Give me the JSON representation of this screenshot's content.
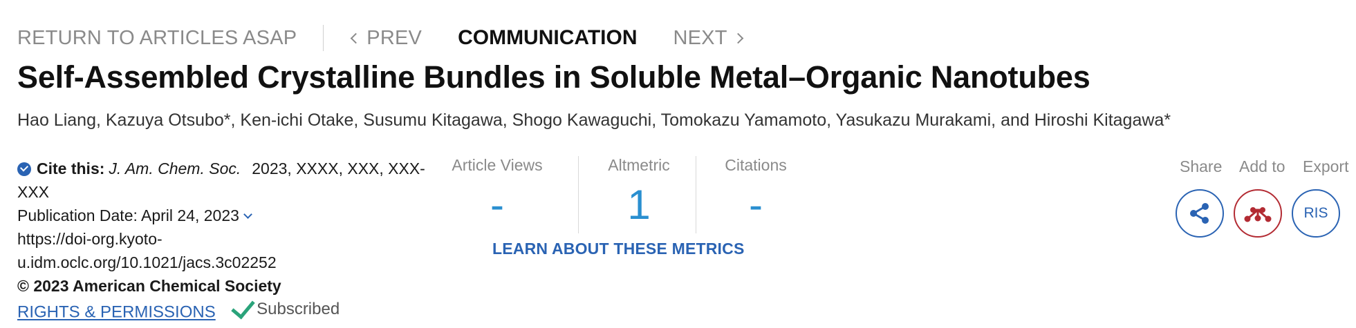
{
  "nav": {
    "return": "RETURN TO ARTICLES ASAP",
    "prev": "PREV",
    "current": "COMMUNICATION",
    "next": "NEXT"
  },
  "article": {
    "title": "Self-Assembled Crystalline Bundles in Soluble Metal–Organic Nanotubes",
    "authors": "Hao Liang, Kazuya Otsubo*, Ken-ichi Otake, Susumu Kitagawa, Shogo Kawaguchi, Tomokazu Yamamoto, Yasukazu Murakami, and Hiroshi Kitagawa*"
  },
  "meta": {
    "cite_label": "Cite this:",
    "journal": "J. Am. Chem. Soc.",
    "cite_rest_1": "2023, XXXX, XXX, XXX-",
    "cite_rest_2": "XXX",
    "pub_date": "Publication Date: April 24, 2023",
    "doi_1": "https://doi-org.kyoto-",
    "doi_2": "u.idm.oclc.org/10.1021/jacs.3c02252",
    "copyright": "© 2023 American Chemical Society",
    "rights": "RIGHTS & PERMISSIONS",
    "subscribed": "Subscribed"
  },
  "metrics": {
    "views_label": "Article Views",
    "views_value": "-",
    "altmetric_label": "Altmetric",
    "altmetric_value": "1",
    "citations_label": "Citations",
    "citations_value": "-",
    "learn": "LEARN ABOUT THESE METRICS"
  },
  "actions": {
    "share": "Share",
    "add_to": "Add to",
    "export": "Export",
    "ris": "RIS"
  },
  "colors": {
    "accent_blue": "#2a63b3",
    "metric_blue": "#2a8fd0",
    "mendeley_red": "#b32b33",
    "subscribed_green": "#2aa37a"
  }
}
